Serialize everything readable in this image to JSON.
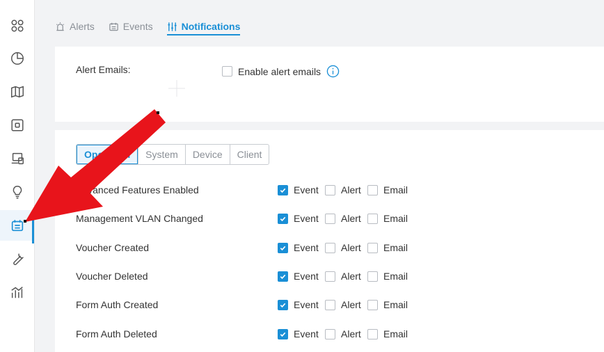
{
  "sidebar": {
    "icons": [
      "grid-icon",
      "pie-chart-icon",
      "map-icon",
      "device-icon",
      "devices-icon",
      "bulb-icon",
      "log-icon",
      "wrench-icon",
      "stats-icon"
    ],
    "active_index": 6
  },
  "tabs": [
    {
      "label": "Alerts",
      "icon": "alarm-icon"
    },
    {
      "label": "Events",
      "icon": "events-icon"
    },
    {
      "label": "Notifications",
      "icon": "sliders-icon",
      "active": true
    }
  ],
  "alert_emails": {
    "label": "Alert Emails:",
    "checkbox_label": "Enable alert emails",
    "checked": false
  },
  "segments": [
    "Operation",
    "System",
    "Device",
    "Client"
  ],
  "active_segment": "Operation",
  "options": {
    "event": "Event",
    "alert": "Alert",
    "email": "Email"
  },
  "rows": [
    {
      "name": "Advanced Features Enabled",
      "event": true,
      "alert": false,
      "email": false
    },
    {
      "name": "Management VLAN Changed",
      "event": true,
      "alert": false,
      "email": false
    },
    {
      "name": "Voucher Created",
      "event": true,
      "alert": false,
      "email": false
    },
    {
      "name": "Voucher Deleted",
      "event": true,
      "alert": false,
      "email": false
    },
    {
      "name": "Form Auth Created",
      "event": true,
      "alert": false,
      "email": false
    },
    {
      "name": "Form Auth Deleted",
      "event": true,
      "alert": false,
      "email": false
    }
  ],
  "colors": {
    "accent": "#1a8fd6",
    "arrow": "#e8141b"
  }
}
